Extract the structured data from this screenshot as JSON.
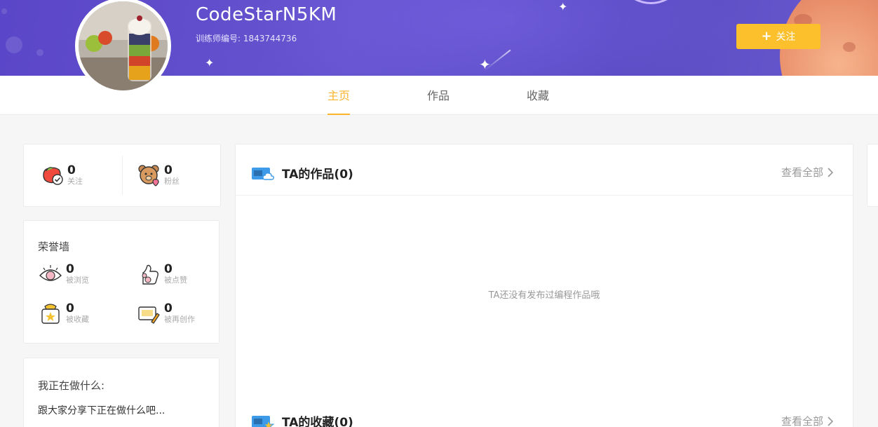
{
  "profile": {
    "username": "CodeStarN5KM",
    "trainer_id": "训练师编号: 1843744736",
    "follow_button": "关注"
  },
  "tabs": [
    {
      "label": "主页",
      "active": true
    },
    {
      "label": "作品",
      "active": false
    },
    {
      "label": "收藏",
      "active": false
    }
  ],
  "social": {
    "following": {
      "count": "0",
      "label": "关注",
      "icon": "apple-check-icon"
    },
    "fans": {
      "count": "0",
      "label": "粉丝",
      "icon": "bear-heart-icon"
    }
  },
  "honor_wall": {
    "title": "荣誉墙",
    "items": [
      {
        "count": "0",
        "label": "被浏览",
        "icon": "eye-icon"
      },
      {
        "count": "0",
        "label": "被点赞",
        "icon": "thumbs-up-icon"
      },
      {
        "count": "0",
        "label": "被收藏",
        "icon": "star-box-icon"
      },
      {
        "count": "0",
        "label": "被再创作",
        "icon": "pencil-card-icon"
      }
    ]
  },
  "doing": {
    "title": "我正在做什么:",
    "text": "跟大家分享下正在做什么吧..."
  },
  "works_section": {
    "title": "TA的作品(0)",
    "view_all": "查看全部",
    "empty_text": "TA还没有发布过编程作品哦"
  },
  "favorites_section": {
    "title": "TA的收藏(0)",
    "view_all": "查看全部"
  },
  "colors": {
    "banner": "#5a46c8",
    "accent": "#fcb32d",
    "follow_button": "#fcc02d"
  }
}
